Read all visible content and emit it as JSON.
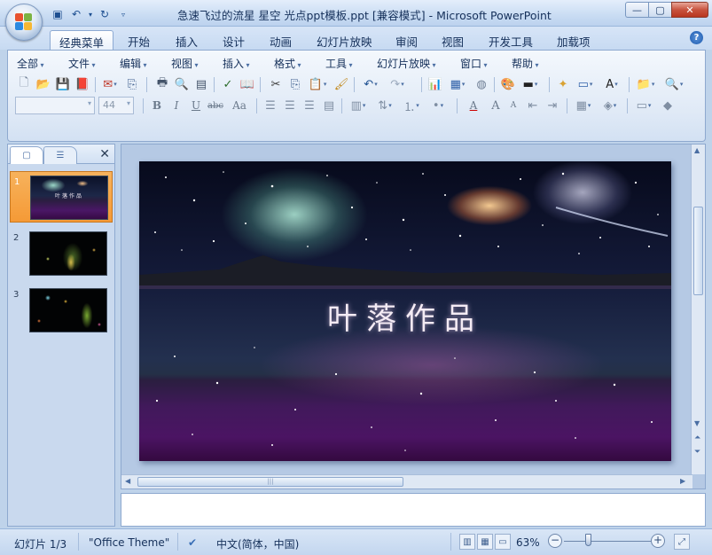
{
  "window": {
    "title": "急速飞过的流星 星空 光点ppt模板.ppt [兼容模式] - Microsoft PowerPoint",
    "controls": {
      "minimize": "—",
      "maximize": "▢",
      "close": "✕"
    }
  },
  "ribbon_tabs": [
    "经典菜单",
    "开始",
    "插入",
    "设计",
    "动画",
    "幻灯片放映",
    "审阅",
    "视图",
    "开发工具",
    "加载项"
  ],
  "active_tab": "经典菜单",
  "classic_menu": [
    "全部",
    "文件",
    "编辑",
    "视图",
    "插入",
    "格式",
    "工具",
    "幻灯片放映",
    "窗口",
    "帮助"
  ],
  "format_bar": {
    "font_name": "",
    "font_size": "44",
    "bold": "B",
    "italic": "I",
    "underline": "U",
    "strikethrough": "abc",
    "change_case": "Aa",
    "font_color": "A",
    "grow_font": "A",
    "shrink_font": "A",
    "text_box_label": "A"
  },
  "slides_pane": {
    "slides": [
      {
        "number": "1",
        "thumb_title": "叶落作品"
      },
      {
        "number": "2"
      },
      {
        "number": "3"
      }
    ],
    "selected": 1
  },
  "current_slide": {
    "title": "叶落作品"
  },
  "statusbar": {
    "slide_indicator": "幻灯片 1/3",
    "theme": "\"Office Theme\"",
    "language": "中文(简体，中国)",
    "zoom": "63%",
    "zoom_out": "−",
    "zoom_in": "+"
  },
  "colors": {
    "accent": "#1c5aae",
    "selected_thumb": "#f59a36",
    "ribbon_bg": "#dfe9f6"
  }
}
